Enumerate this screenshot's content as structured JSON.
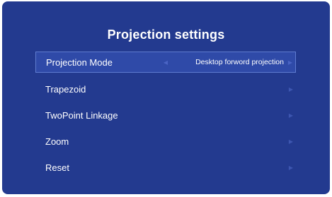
{
  "title": "Projection settings",
  "menu": {
    "items": [
      {
        "label": "Projection Mode",
        "value": "Desktop forword projection"
      },
      {
        "label": "Trapezoid"
      },
      {
        "label": "TwoPoint Linkage"
      },
      {
        "label": "Zoom"
      },
      {
        "label": "Reset"
      }
    ]
  },
  "colors": {
    "background": "#233a8f",
    "selected": "#2f4aa8",
    "text": "#ffffff"
  },
  "icons": {
    "left": "chevron-left-icon",
    "right": "chevron-right-icon"
  }
}
